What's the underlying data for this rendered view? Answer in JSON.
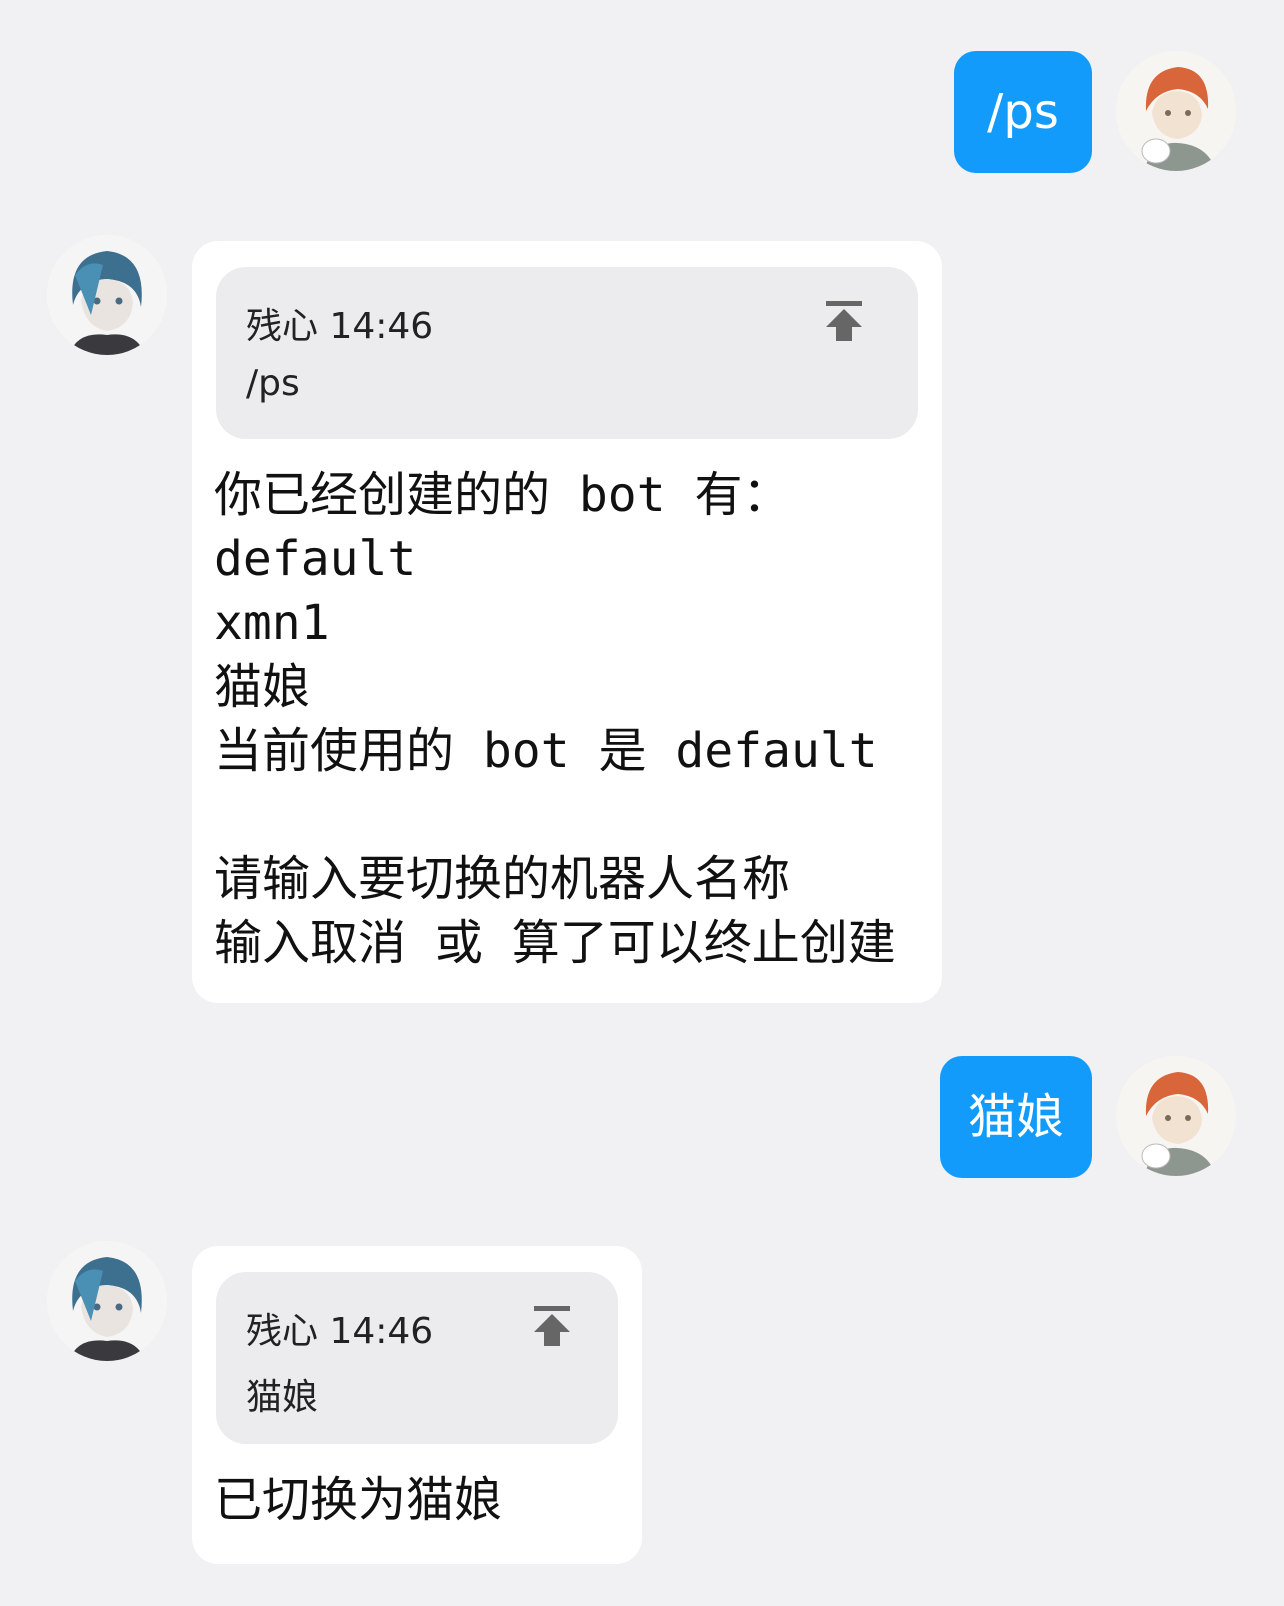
{
  "messages": [
    {
      "side": "sent",
      "avatar": "user-avatar-red-hair",
      "text": "/ps"
    },
    {
      "side": "received",
      "avatar": "bot-avatar-blue-hair",
      "quote": {
        "sender": "残心",
        "time": "14:46",
        "text": "/ps",
        "icon": "jump-to-top-icon"
      },
      "body": "你已经创建的的 bot 有：\ndefault\nxmn1\n猫娘\n当前使用的 bot 是 default\n\n请输入要切换的机器人名称\n输入取消 或 算了可以终止创建"
    },
    {
      "side": "sent",
      "avatar": "user-avatar-red-hair",
      "text": "猫娘"
    },
    {
      "side": "received",
      "avatar": "bot-avatar-blue-hair",
      "quote": {
        "sender": "残心",
        "time": "14:46",
        "text": "猫娘",
        "icon": "jump-to-top-icon"
      },
      "body": "已切换为猫娘"
    }
  ],
  "colors": {
    "background": "#f1f1f3",
    "sent_bubble": "#129bfa",
    "received_card": "#ffffff",
    "quote_bg": "#ececef"
  }
}
